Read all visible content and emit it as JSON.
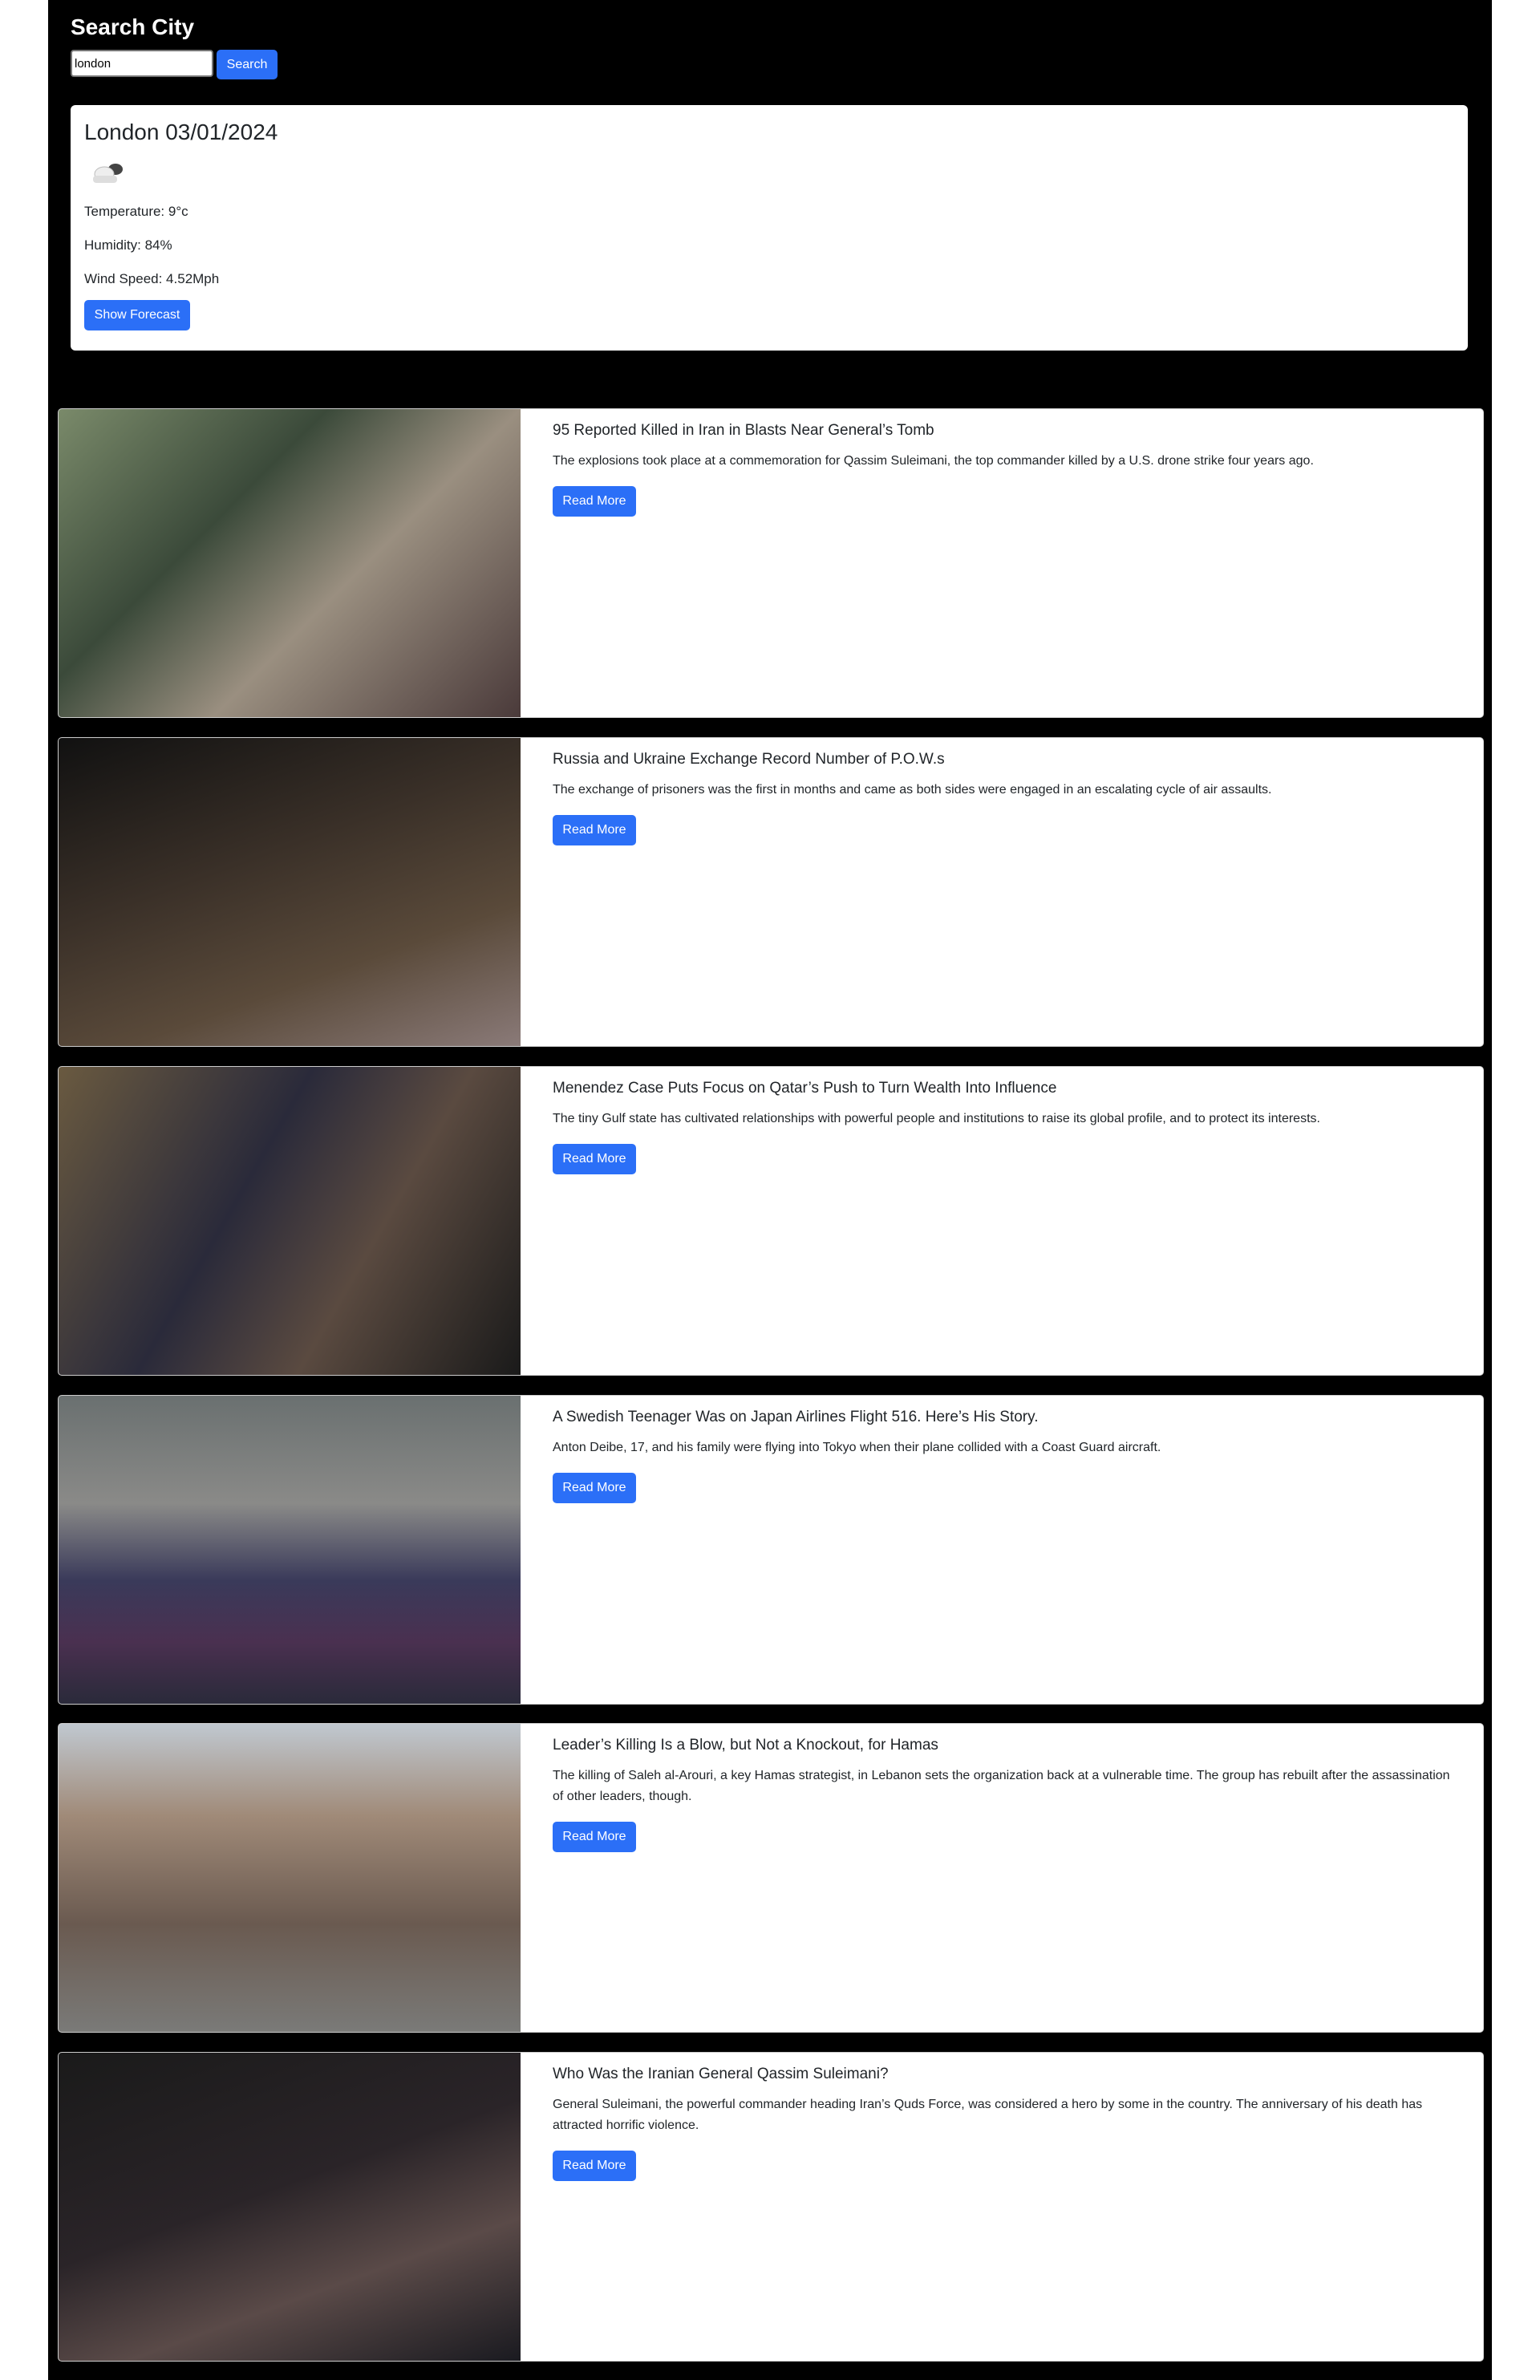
{
  "header": {
    "title": "Search City",
    "search_value": "london",
    "search_button": "Search"
  },
  "weather": {
    "heading": "London 03/01/2024",
    "icon": "cloud-icon",
    "temperature": "Temperature: 9°c",
    "humidity": "Humidity: 84%",
    "wind": "Wind Speed: 4.52Mph",
    "forecast_button": "Show Forecast"
  },
  "colors": {
    "accent": "#2b6ff7",
    "background": "#000000"
  },
  "articles": [
    {
      "title": "95 Reported Killed in Iran in Blasts Near General’s Tomb",
      "description": "The explosions took place at a commemoration for Qassim Suleimani, the top commander killed by a U.S. drone strike four years ago.",
      "button": "Read More"
    },
    {
      "title": "Russia and Ukraine Exchange Record Number of P.O.W.s",
      "description": "The exchange of prisoners was the first in months and came as both sides were engaged in an escalating cycle of air assaults.",
      "button": "Read More"
    },
    {
      "title": "Menendez Case Puts Focus on Qatar’s Push to Turn Wealth Into Influence",
      "description": "The tiny Gulf state has cultivated relationships with powerful people and institutions to raise its global profile, and to protect its interests.",
      "button": "Read More"
    },
    {
      "title": "A Swedish Teenager Was on Japan Airlines Flight 516. Here’s His Story.",
      "description": "Anton Deibe, 17, and his family were flying into Tokyo when their plane collided with a Coast Guard aircraft.",
      "button": "Read More"
    },
    {
      "title": "Leader’s Killing Is a Blow, but Not a Knockout, for Hamas",
      "description": "The killing of Saleh al-Arouri, a key Hamas strategist, in Lebanon sets the organization back at a vulnerable time. The group has rebuilt after the assassination of other leaders, though.",
      "button": "Read More"
    },
    {
      "title": "Who Was the Iranian General Qassim Suleimani?",
      "description": "General Suleimani, the powerful commander heading Iran’s Quds Force, was considered a hero by some in the country. The anniversary of his death has attracted horrific violence.",
      "button": "Read More"
    }
  ]
}
